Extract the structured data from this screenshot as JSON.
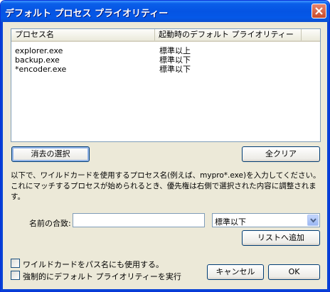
{
  "window": {
    "title": "デフォルト プロセス プライオリティー"
  },
  "list": {
    "columns": [
      "プロセス名",
      "起動時のデフォルト プライオリティー"
    ],
    "rows": [
      {
        "process": "explorer.exe",
        "priority": "標準以上"
      },
      {
        "process": "backup.exe",
        "priority": "標準以下"
      },
      {
        "process": "*encoder.exe",
        "priority": "標準以下"
      }
    ]
  },
  "buttons": {
    "clear_selection": "消去の選択",
    "clear_all": "全クリア",
    "add_to_list": "リストへ追加",
    "cancel": "キャンセル",
    "ok": "OK"
  },
  "description": "以下で、ワイルドカードを使用するプロセス名(例えば、mypro*.exe)を入力してください。これにマッチするプロセスが始められるとき、優先権は右側で選択された内容に調整されます。",
  "form": {
    "name_label": "名前の合致:",
    "name_value": "",
    "priority_selected": "標準以下"
  },
  "options": {
    "wildcard_path": {
      "label": "ワイルドカードをパス名にも使用する。",
      "checked": false
    },
    "force_default": {
      "label": "強制的にデフォルト プライオリティーを実行",
      "checked": false
    }
  }
}
